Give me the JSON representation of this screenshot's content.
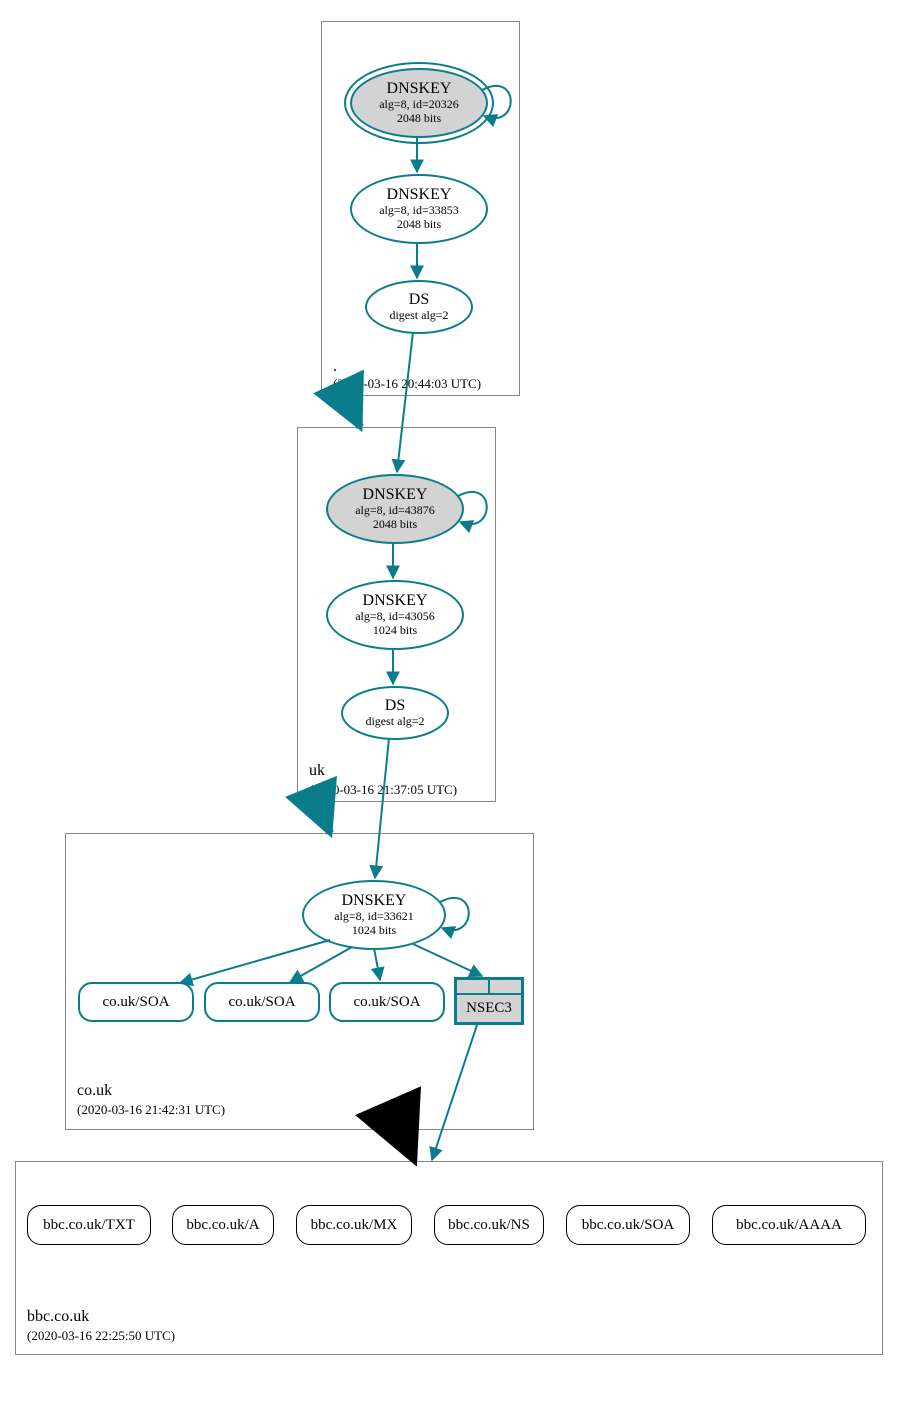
{
  "zones": {
    "root": {
      "label": ".",
      "time": "(2020-03-16 20:44:03 UTC)"
    },
    "uk": {
      "label": "uk",
      "time": "(2020-03-16 21:37:05 UTC)"
    },
    "couk": {
      "label": "co.uk",
      "time": "(2020-03-16 21:42:31 UTC)"
    },
    "bbc": {
      "label": "bbc.co.uk",
      "time": "(2020-03-16 22:25:50 UTC)"
    }
  },
  "nodes": {
    "root_k1": {
      "t": "DNSKEY",
      "s1": "alg=8, id=20326",
      "s2": "2048 bits"
    },
    "root_k2": {
      "t": "DNSKEY",
      "s1": "alg=8, id=33853",
      "s2": "2048 bits"
    },
    "root_ds": {
      "t": "DS",
      "s1": "digest alg=2"
    },
    "uk_k1": {
      "t": "DNSKEY",
      "s1": "alg=8, id=43876",
      "s2": "2048 bits"
    },
    "uk_k2": {
      "t": "DNSKEY",
      "s1": "alg=8, id=43056",
      "s2": "1024 bits"
    },
    "uk_ds": {
      "t": "DS",
      "s1": "digest alg=2"
    },
    "couk_k1": {
      "t": "DNSKEY",
      "s1": "alg=8, id=33621",
      "s2": "1024 bits"
    },
    "couk_soa1": {
      "t": "co.uk/SOA"
    },
    "couk_soa2": {
      "t": "co.uk/SOA"
    },
    "couk_soa3": {
      "t": "co.uk/SOA"
    },
    "nsec3": {
      "t": "NSEC3"
    },
    "bbc_txt": {
      "t": "bbc.co.uk/TXT"
    },
    "bbc_a": {
      "t": "bbc.co.uk/A"
    },
    "bbc_mx": {
      "t": "bbc.co.uk/MX"
    },
    "bbc_ns": {
      "t": "bbc.co.uk/NS"
    },
    "bbc_soa": {
      "t": "bbc.co.uk/SOA"
    },
    "bbc_aaaa": {
      "t": "bbc.co.uk/AAAA"
    }
  },
  "colors": {
    "teal": "#0a7d8c",
    "gray": "#d3d3d3"
  }
}
